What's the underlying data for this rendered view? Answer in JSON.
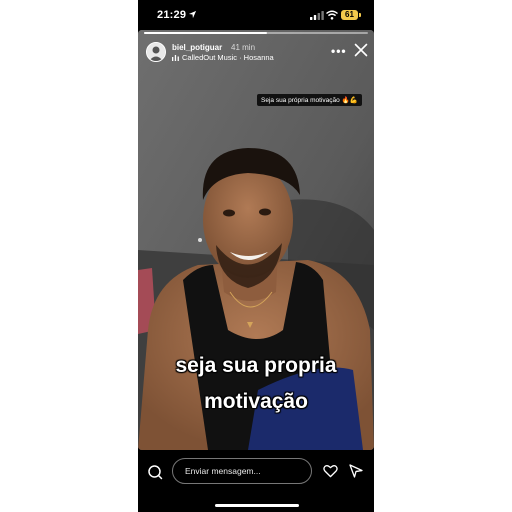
{
  "status_bar": {
    "time": "21:29",
    "battery": "61",
    "icons": [
      "location-arrow-icon",
      "signal-icon",
      "wifi-icon",
      "battery-icon"
    ]
  },
  "story": {
    "progress": 0.55,
    "username": "biel_potiguar",
    "posted": "41 min",
    "music": "CalledOut Music · Hosanna",
    "more_label": "•••",
    "sticker_text": "Seja sua própria motivação 🔥💪",
    "caption_line1": "seja sua propria",
    "caption_line2": "motivação",
    "icons": [
      "more-icon",
      "close-icon",
      "music-bars-icon"
    ]
  },
  "reply_bar": {
    "placeholder": "Enviar mensagem...",
    "icons": [
      "camera-icon",
      "heart-icon",
      "send-icon"
    ]
  },
  "colors": {
    "background": "#000000",
    "battery": "#f2c94c",
    "text": "#ffffff"
  }
}
